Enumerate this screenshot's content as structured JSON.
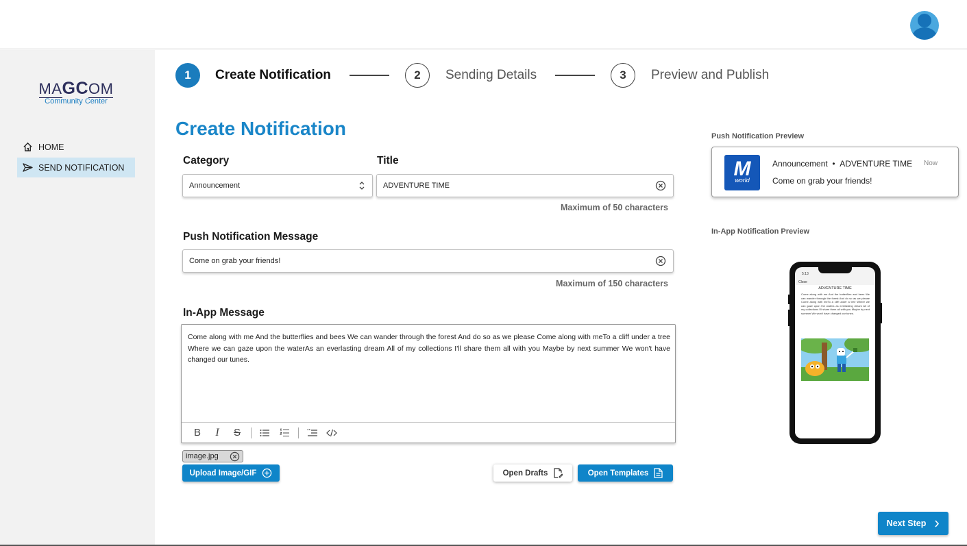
{
  "logo": {
    "main_pre": "MA",
    "main_bold": "GC",
    "main_post": "OM",
    "sub": "Community Center"
  },
  "sidebar": {
    "items": [
      {
        "label": "HOME",
        "icon": "home-icon"
      },
      {
        "label": "SEND NOTIFICATION",
        "icon": "send-icon",
        "active": true
      }
    ]
  },
  "stepper": {
    "steps": [
      {
        "number": "1",
        "label": "Create Notification",
        "active": true
      },
      {
        "number": "2",
        "label": "Sending Details",
        "active": false
      },
      {
        "number": "3",
        "label": "Preview and Publish",
        "active": false
      }
    ]
  },
  "page_title": "Create Notification",
  "form": {
    "category_label": "Category",
    "category_value": "Announcement",
    "title_label": "Title",
    "title_value": "ADVENTURE TIME",
    "title_hint": "Maximum of 50 characters",
    "push_label": "Push Notification Message",
    "push_value": "Come on grab your friends!",
    "push_hint": "Maximum of 150 characters",
    "inapp_label": "In-App Message",
    "inapp_value": "Come along with me And the butterflies and bees We can wander through the forest And do so as we please Come along with meTo a cliff under a tree Where we can gaze upon the waterAs an everlasting dream All of my collections I'll share them all with you Maybe by next summer We won't have changed our tunes.",
    "attachment": "image.jpg",
    "upload_label": "Upload Image/GIF",
    "drafts_label": "Open Drafts",
    "templates_label": "Open Templates"
  },
  "push_preview": {
    "label": "Push Notification Preview",
    "category": "Announcement",
    "separator": "•",
    "title": "ADVENTURE TIME",
    "time": "Now",
    "message": "Come on grab your friends!",
    "logo_letter": "M",
    "logo_word": "world"
  },
  "inapp_preview": {
    "label": "In-App Notification Preview",
    "status_time": "5:13",
    "close_label": "Close",
    "title": "ADVENTURE TIME",
    "text": "Come along with me And the butterflies and bees We can wander through the forest And do so as we please Come along with meTo a cliff under a tree Where we can gaze upon the waters as everlasting dream All of my collections I'll share them all with you Maybe by next summer We won't have changed our tunes."
  },
  "next_label": "Next Step",
  "colors": {
    "accent": "#0f85c9",
    "title": "#1a86c8",
    "sidebar_active": "#cfe6f3"
  }
}
